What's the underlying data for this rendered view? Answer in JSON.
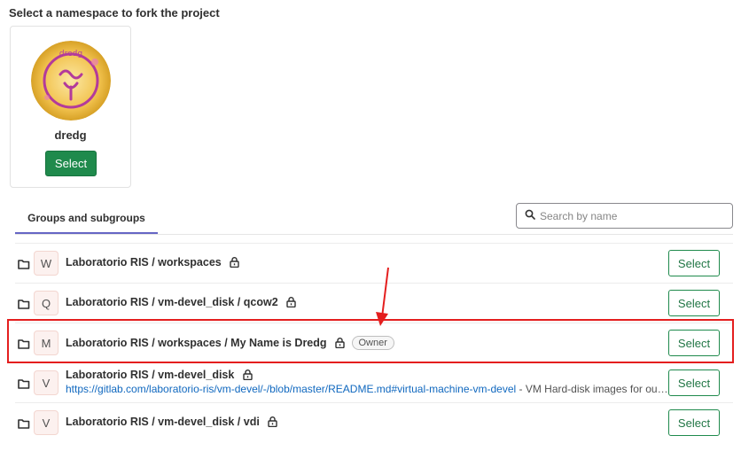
{
  "page": {
    "heading": "Select a namespace to fork the project"
  },
  "namespace_card": {
    "name": "dredg",
    "avatar_text": "dredg",
    "select_label": "Select"
  },
  "tabs": {
    "active": "Groups and subgroups"
  },
  "search": {
    "placeholder": "Search by name"
  },
  "groups": [
    {
      "letter": "W",
      "title": "Laboratorio RIS / workspaces",
      "select_label": "Select"
    },
    {
      "letter": "Q",
      "title": "Laboratorio RIS / vm-devel_disk / qcow2",
      "select_label": "Select"
    },
    {
      "letter": "M",
      "title": "Laboratorio RIS / workspaces / My Name is Dredg",
      "role": "Owner",
      "select_label": "Select"
    },
    {
      "letter": "V",
      "title": "Laboratorio RIS / vm-devel_disk",
      "link": "https://gitlab.com/laboratorio-ris/vm-devel/-/blob/master/README.md#virtual-machine-vm-devel",
      "description": " - VM Hard-disk images for our virtual machine",
      "select_label": "Select"
    },
    {
      "letter": "V",
      "title": "Laboratorio RIS / vm-devel_disk / vdi",
      "select_label": "Select"
    }
  ],
  "colors": {
    "primary_button": "#1f8a4c",
    "tab_underline": "#6666c4",
    "annotation": "#e41e1e",
    "link": "#1068bf"
  }
}
